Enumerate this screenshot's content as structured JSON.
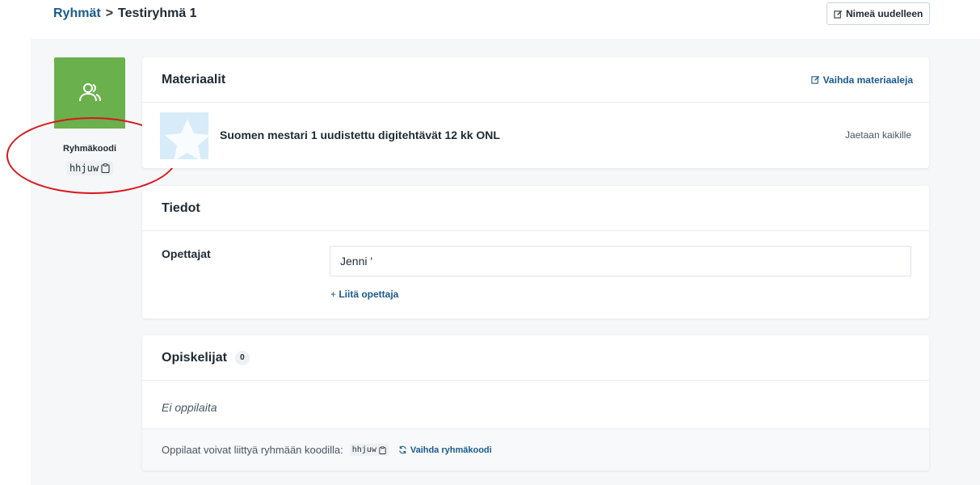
{
  "breadcrumb": {
    "parent": "Ryhmät",
    "separator": ">",
    "current": "Testiryhmä 1"
  },
  "rename_button": "Nimeä uudelleen",
  "group": {
    "code_label": "Ryhmäkoodi",
    "code": "hhjuw",
    "tile_color": "#6ab04c"
  },
  "materials": {
    "title": "Materiaalit",
    "change_link": "Vaihda materiaaleja",
    "items": [
      {
        "title": "Suomen mestari 1 uudistettu digitehtävät 12 kk ONL",
        "sharing": "Jaetaan kaikille"
      }
    ]
  },
  "info": {
    "title": "Tiedot",
    "teachers_label": "Opettajat",
    "teacher_value": "Jenni '",
    "add_teacher": "Liitä opettaja"
  },
  "students": {
    "title": "Opiskelijat",
    "count": "0",
    "empty": "Ei oppilaita",
    "join_text": "Oppilaat voivat liittyä ryhmään koodilla:",
    "code": "hhjuw",
    "change_code": "Vaihda ryhmäkoodi"
  },
  "colors": {
    "accent": "#1a5a8c",
    "annotation": "#d8171c"
  },
  "icons": [
    "edit-icon",
    "users-icon",
    "clipboard-icon",
    "star-icon",
    "plus-icon",
    "refresh-icon"
  ]
}
